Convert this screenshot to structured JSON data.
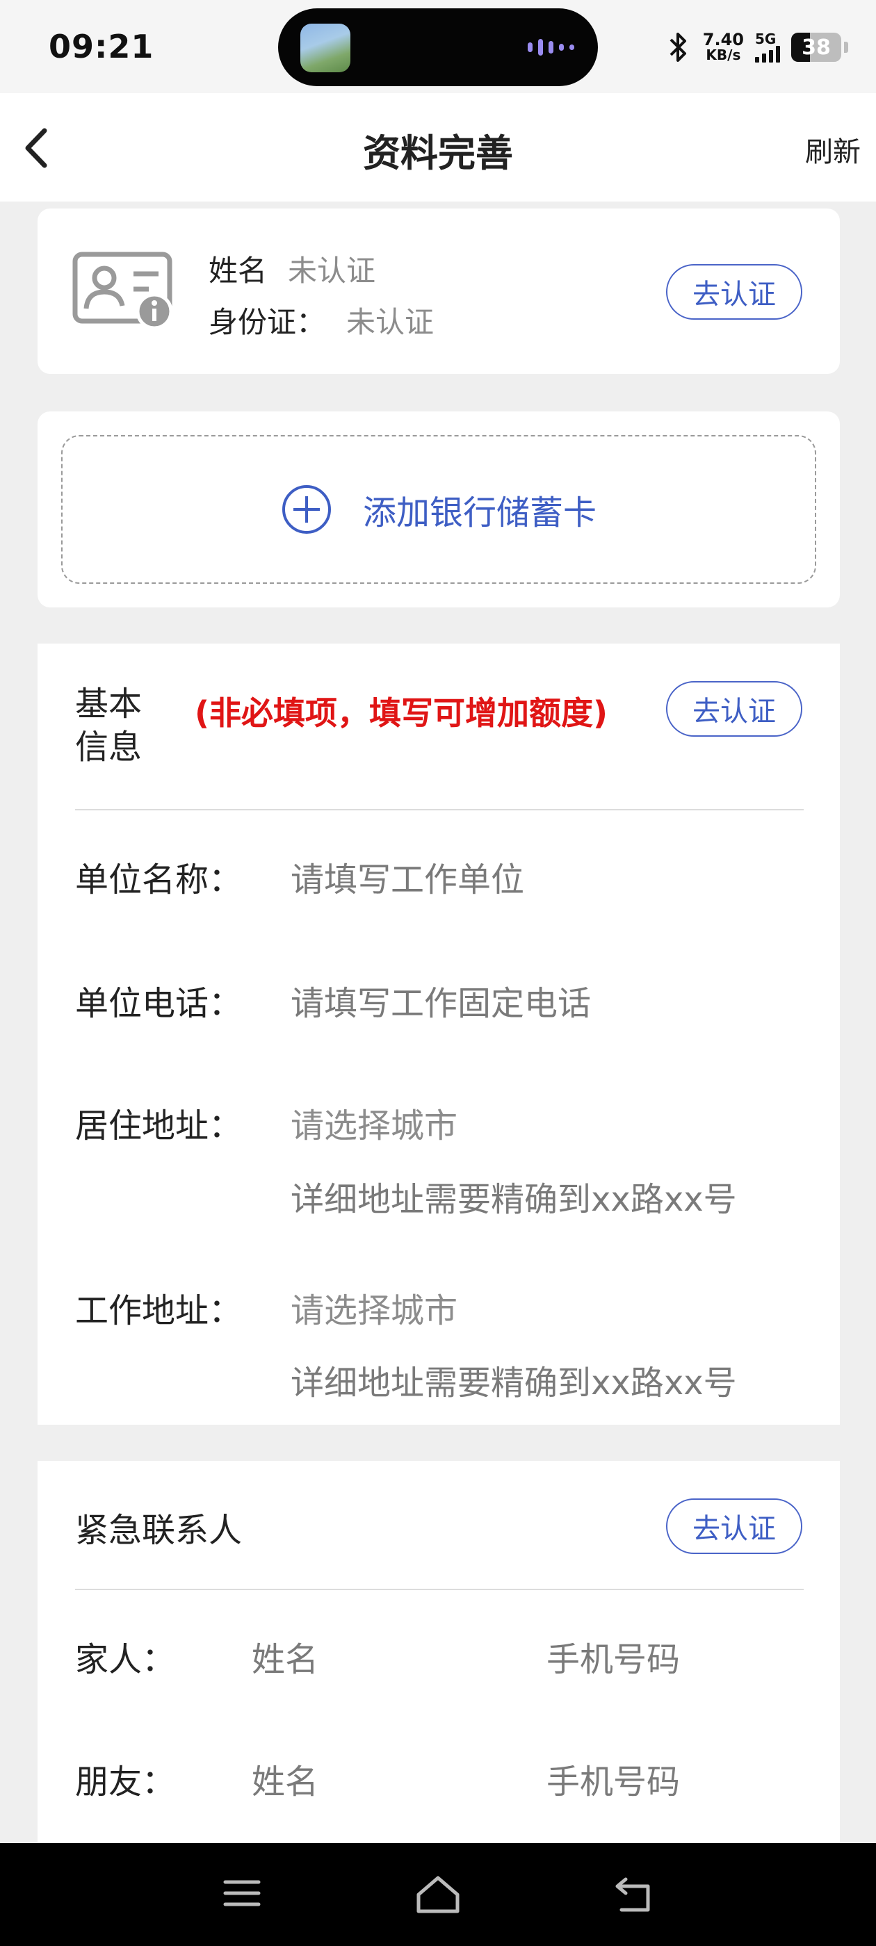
{
  "status_bar": {
    "time": "09:21",
    "net_speed_value": "7.40",
    "net_speed_unit": "KB/s",
    "network_type": "5G",
    "battery_level": "38"
  },
  "nav": {
    "title": "资料完善",
    "refresh_label": "刷新"
  },
  "identity": {
    "name_label": "姓名",
    "name_value": "未认证",
    "id_label": "身份证：",
    "id_value": "未认证",
    "verify_button": "去认证"
  },
  "bank": {
    "add_label": "添加银行储蓄卡"
  },
  "basic_info": {
    "title": "基本信息",
    "note": "(非必填项，填写可增加额度)",
    "verify_button": "去认证",
    "company_name_label": "单位名称：",
    "company_name_placeholder": "请填写工作单位",
    "company_phone_label": "单位电话：",
    "company_phone_placeholder": "请填写工作固定电话",
    "home_address_label": "居住地址：",
    "home_city_placeholder": "请选择城市",
    "home_detail_placeholder": "详细地址需要精确到xx路xx号",
    "work_address_label": "工作地址：",
    "work_city_placeholder": "请选择城市",
    "work_detail_placeholder": "详细地址需要精确到xx路xx号"
  },
  "emergency_contact": {
    "title": "紧急联系人",
    "verify_button": "去认证",
    "family_label": "家人：",
    "family_name_placeholder": "姓名",
    "family_phone_placeholder": "手机号码",
    "friend_label": "朋友：",
    "friend_name_placeholder": "姓名",
    "friend_phone_placeholder": "手机号码"
  },
  "icons": {
    "back": "chevron-left-icon",
    "id_card": "id-card-icon",
    "add": "plus-circle-icon",
    "menu": "menu-icon",
    "home": "home-icon",
    "return": "return-icon"
  },
  "colors": {
    "accent": "#3e5ec4",
    "warning": "#e01515",
    "background": "#efefef"
  }
}
